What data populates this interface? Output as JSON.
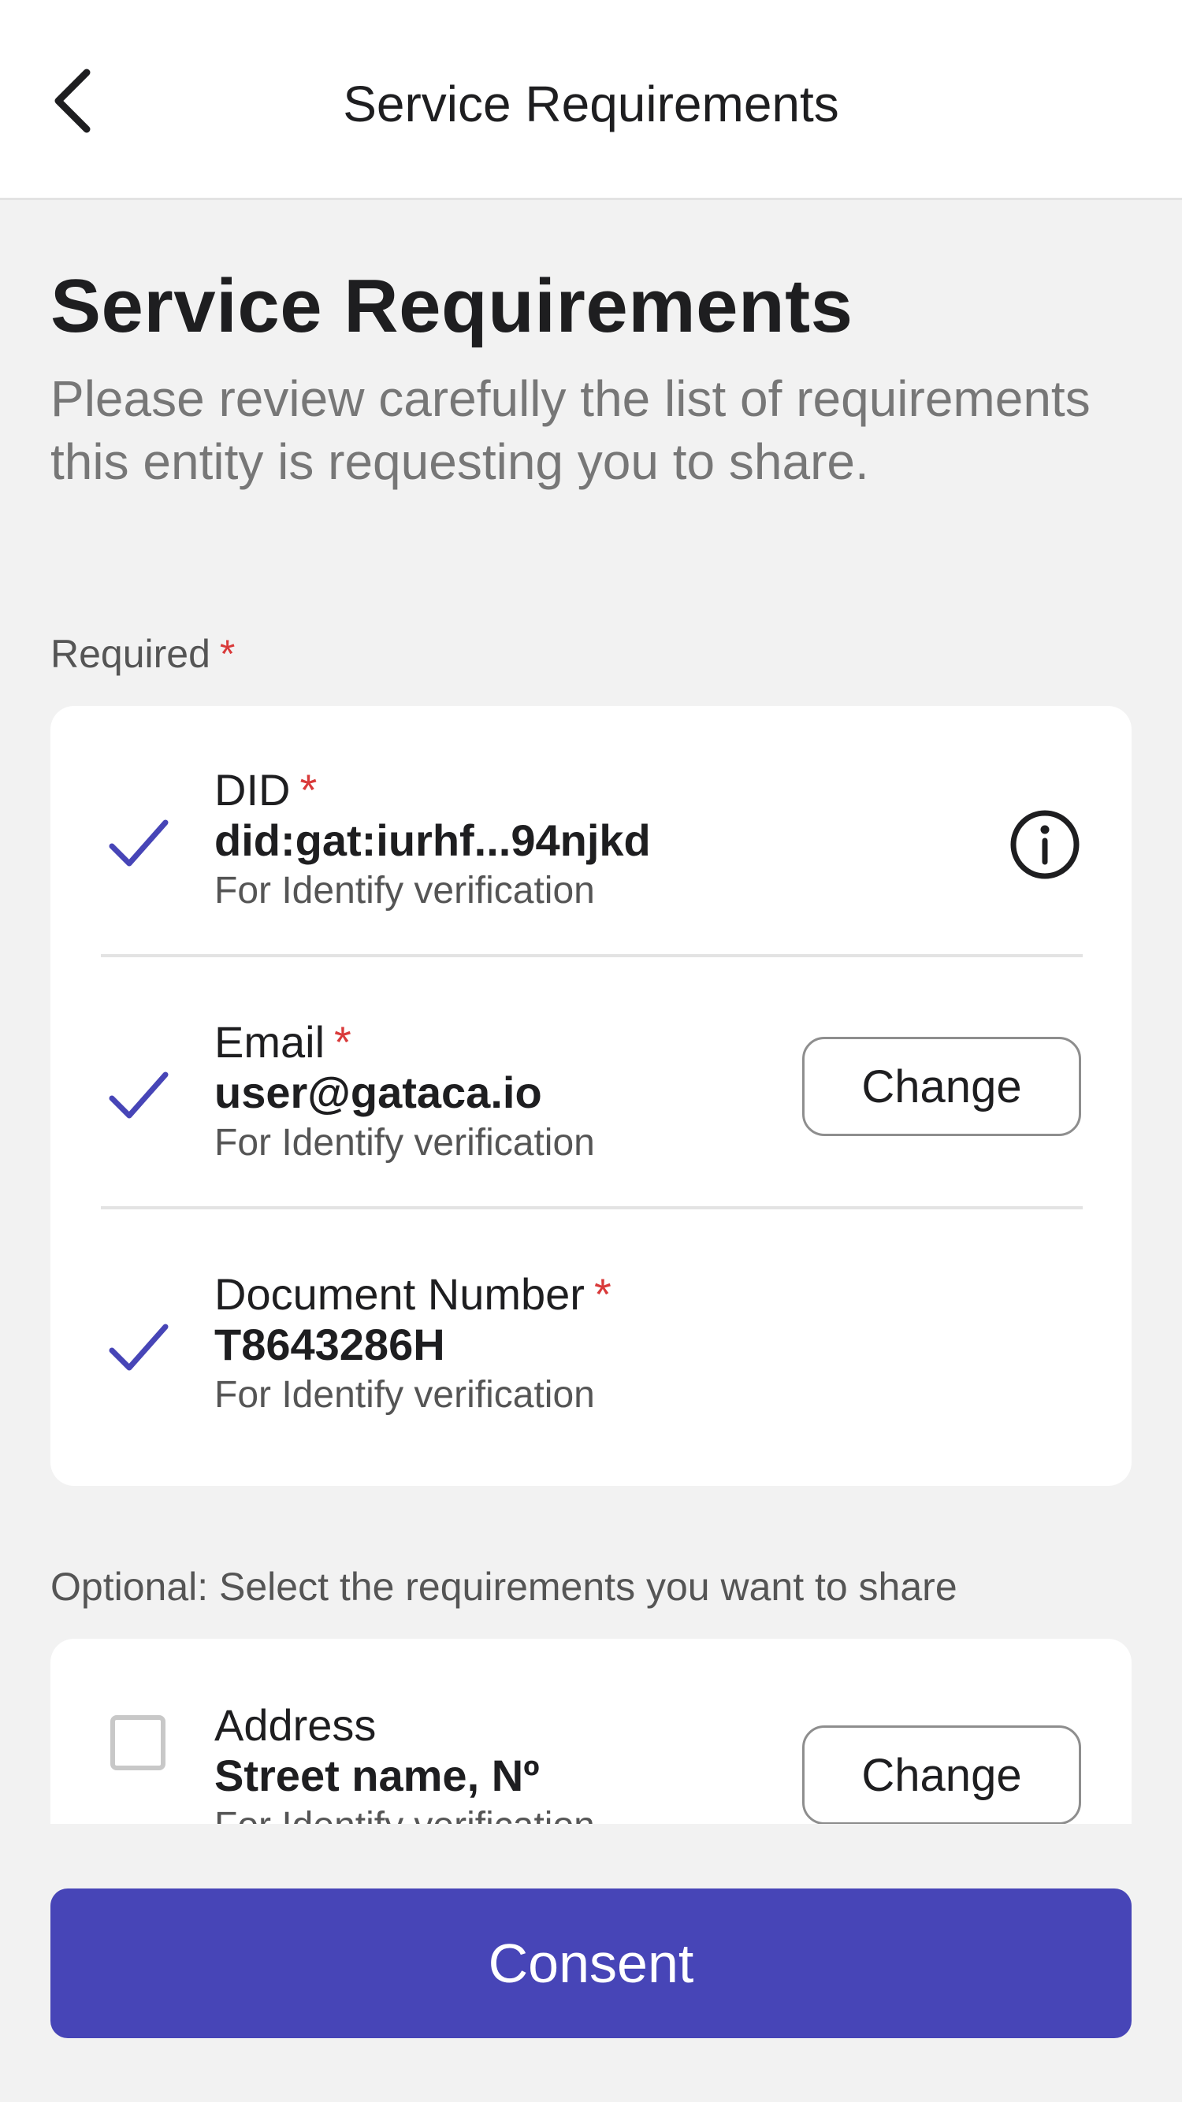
{
  "header": {
    "title": "Service Requirements",
    "back_icon": "chevron-left-icon"
  },
  "page": {
    "title": "Service Requirements",
    "subtitle": "Please review carefully the list of requirements this entity is requesting you to share."
  },
  "required_section": {
    "label": "Required",
    "star": "*",
    "items": [
      {
        "label": "DID",
        "star": "*",
        "value": "did:gat:iurhf...94njkd",
        "purpose": "For Identify verification",
        "checked": true,
        "action": "info-icon"
      },
      {
        "label": "Email",
        "star": "*",
        "value": "user@gataca.io",
        "purpose": "For Identify verification",
        "checked": true,
        "action_label": "Change"
      },
      {
        "label": "Document Number",
        "star": "*",
        "value": "T8643286H",
        "purpose": "For Identify verification",
        "checked": true
      }
    ]
  },
  "optional_section": {
    "label": "Optional: Select the requirements you want to share",
    "items": [
      {
        "label": "Address",
        "value": "Street name, Nº",
        "purpose": "For Identify verification",
        "checked": false,
        "action_label": "Change"
      }
    ]
  },
  "footer": {
    "consent_label": "Consent"
  },
  "colors": {
    "accent": "#4745b7",
    "required_star": "#d93a3a",
    "background": "#f2f2f2"
  }
}
